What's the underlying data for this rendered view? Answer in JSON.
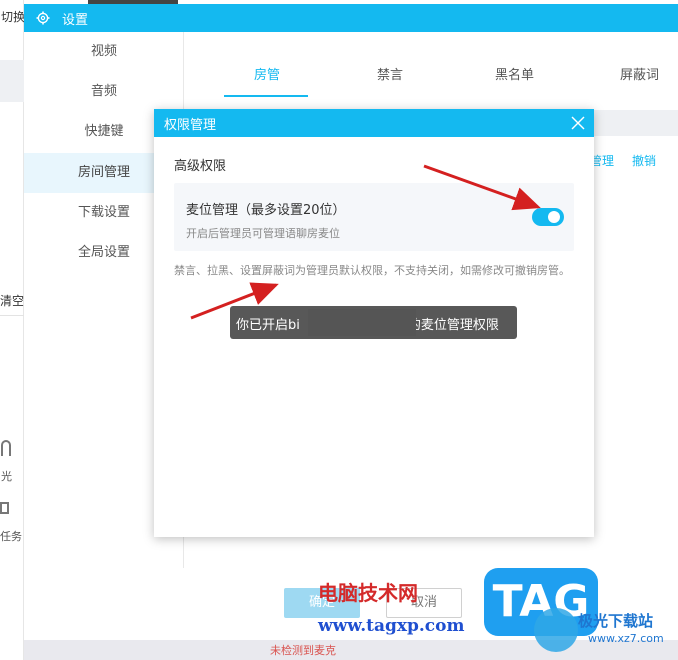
{
  "background": {
    "qiehuan_label": "切换",
    "qingkong_label": "清空",
    "guang_label": "光",
    "renwu_label": "任务",
    "bottom_text": "未检测到麦克"
  },
  "settings_window": {
    "title": "设置",
    "sidebar": {
      "items": [
        {
          "label": "视频"
        },
        {
          "label": "音频"
        },
        {
          "label": "快捷键"
        },
        {
          "label": "房间管理",
          "active": true
        },
        {
          "label": "下载设置"
        },
        {
          "label": "全局设置"
        }
      ]
    },
    "tabs": [
      {
        "label": "房管",
        "active": true
      },
      {
        "label": "禁言"
      },
      {
        "label": "黑名单"
      },
      {
        "label": "屏蔽词"
      }
    ],
    "row_actions": [
      "管理",
      "撤销"
    ],
    "footer": {
      "ok_label": "确定",
      "cancel_label": "取消"
    }
  },
  "dialog": {
    "title": "权限管理",
    "section_title": "高级权限",
    "permission": {
      "label": "麦位管理（最多设置20位）",
      "description": "开启后管理员可管理语聊房麦位",
      "enabled": true
    },
    "note": "禁言、拉黑、设置屏蔽词为管理员默认权限，不支持关闭，如需修改可撤销房管。"
  },
  "toast": {
    "text_prefix": "你已开启bi",
    "text_suffix": "的麦位管理权限"
  },
  "watermark": {
    "cn_text": "电脑技术网",
    "url": "www.tagxp.com",
    "badge": "TAG",
    "xz_text": "极光下载站",
    "xz_url": "www.xz7.com"
  },
  "colors": {
    "accent": "#14b9f0",
    "arrow": "#d42020"
  }
}
